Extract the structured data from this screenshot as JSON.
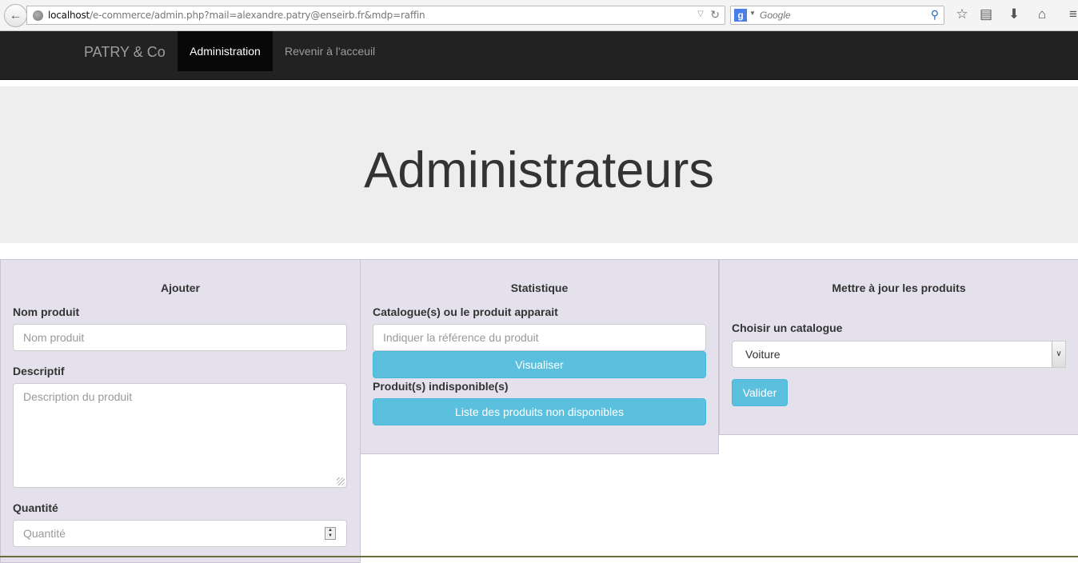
{
  "browser": {
    "url_host": "localhost",
    "url_rest": "/e-commerce/admin.php?mail=alexandre.patry@enseirb.fr&mdp=raffin",
    "search_engine_letter": "g",
    "search_placeholder": "Google",
    "icons": [
      "back-arrow-icon",
      "globe-icon",
      "reload-icon",
      "search-icon",
      "star-icon",
      "reading-list-icon",
      "download-icon",
      "home-icon",
      "menu-icon"
    ]
  },
  "navbar": {
    "brand": "PATRY & Co",
    "active_item": "Administration",
    "link": "Revenir à l'acceuil"
  },
  "jumbotron": {
    "title": "Administrateurs"
  },
  "panels": {
    "add": {
      "title": "Ajouter",
      "name_label": "Nom produit",
      "name_placeholder": "Nom produit",
      "desc_label": "Descriptif",
      "desc_placeholder": "Description du produit",
      "qty_label": "Quantité",
      "qty_placeholder": "Quantité"
    },
    "stats": {
      "title": "Statistique",
      "catalog_label": "Catalogue(s) ou le produit apparait",
      "ref_placeholder": "Indiquer la référence du produit",
      "visualize_button": "Visualiser",
      "unavailable_label": "Produit(s) indisponible(s)",
      "unavailable_button": "Liste des produits non disponibles"
    },
    "update": {
      "title": "Mettre à jour les produits",
      "catalog_label": "Choisir un catalogue",
      "catalog_selected": "Voiture",
      "submit_button": "Valider"
    }
  },
  "colors": {
    "navbar": "#222222",
    "panel": "#e5e1ec",
    "button_info": "#5bc0de",
    "jumbotron": "#eeeeee"
  }
}
